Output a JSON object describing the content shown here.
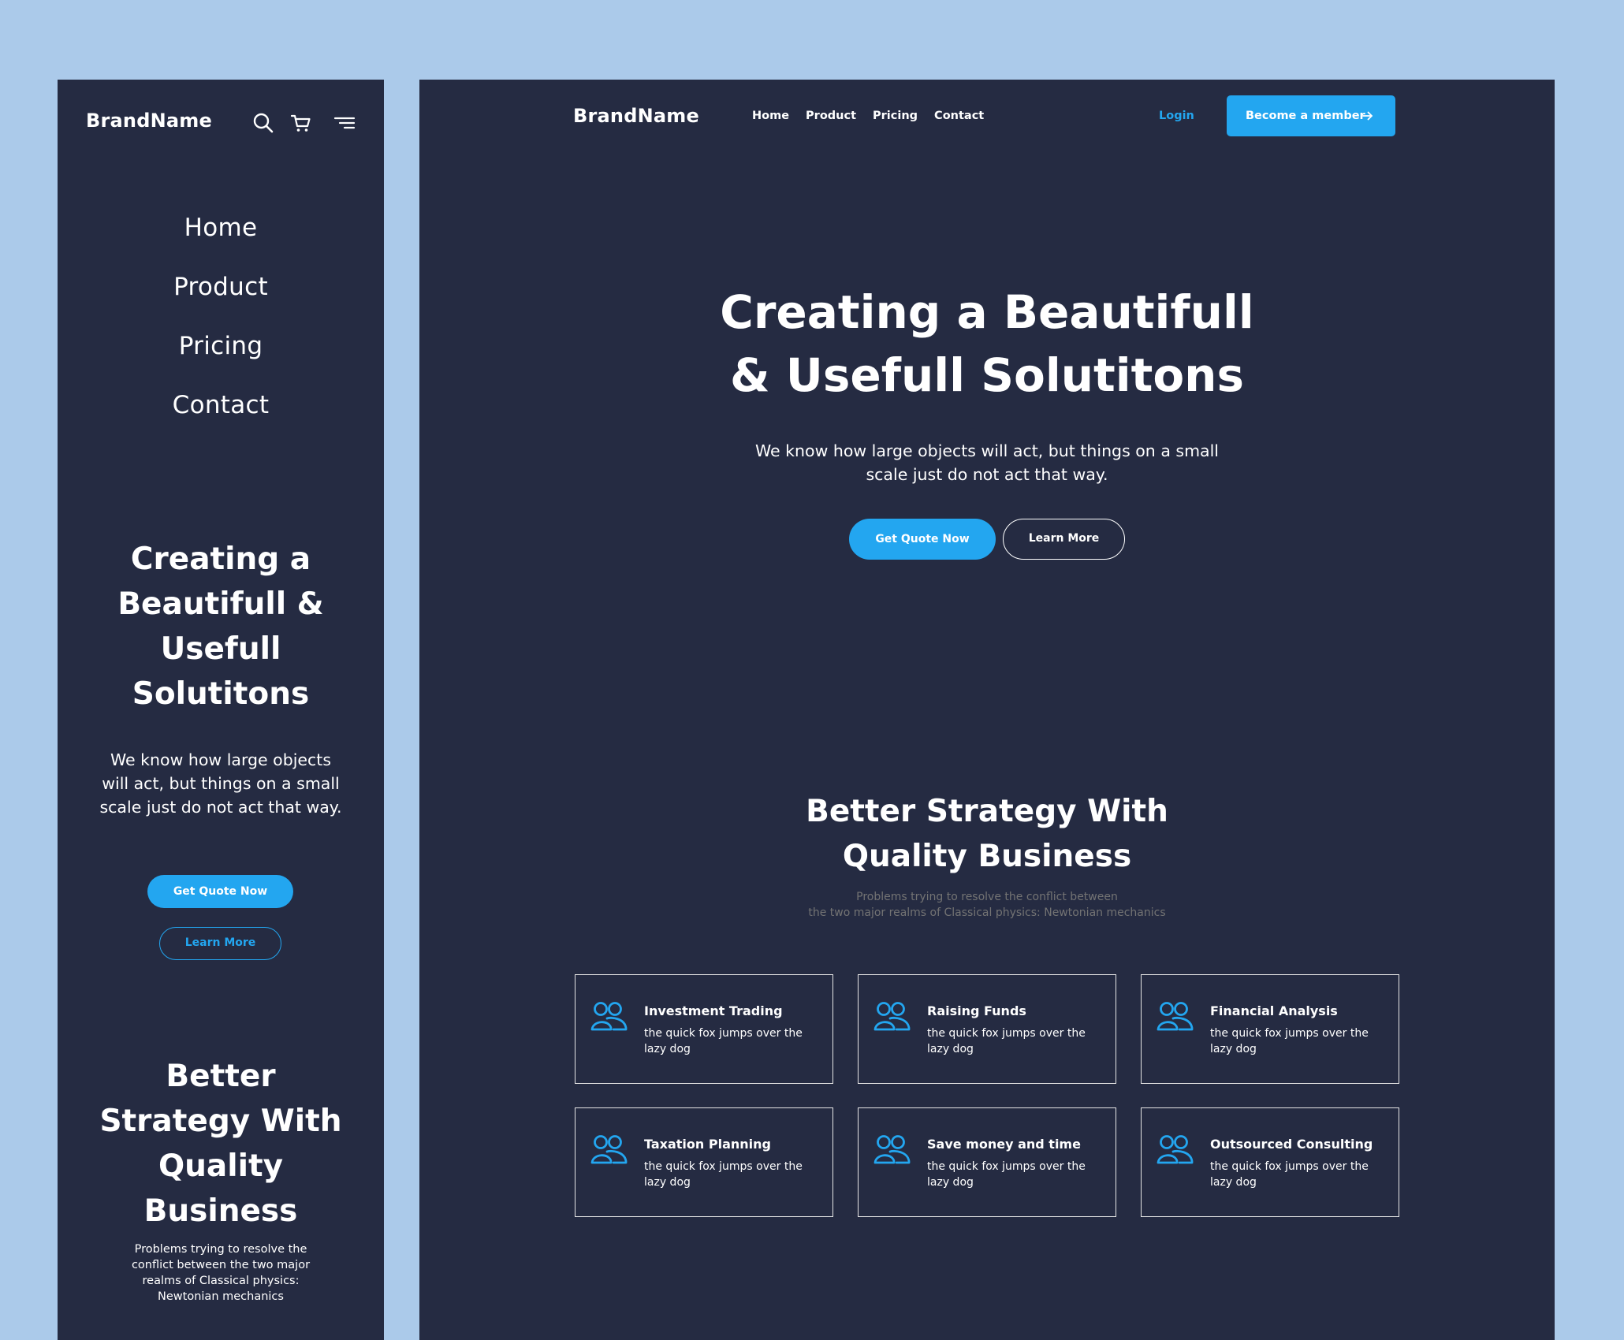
{
  "brand": "BrandName",
  "accent_color": "#23a6f0",
  "background_color": "#252b42",
  "mobile": {
    "header_icons": [
      "search-icon",
      "cart-icon",
      "menu-icon"
    ],
    "nav": [
      "Home",
      "Product",
      "Pricing",
      "Contact"
    ],
    "hero_title": "Creating a Beautifull & Usefull Solutitons",
    "hero_text": "We know how large objects will act, but things on a small scale just do not act that way.",
    "primary_button": "Get Quote Now",
    "secondary_button": "Learn More",
    "section_title": "Better Strategy With Quality Business",
    "section_text": "Problems trying to resolve the conflict between the two major realms of Classical physics: Newtonian mechanics"
  },
  "desktop": {
    "nav": [
      "Home",
      "Product",
      "Pricing",
      "Contact"
    ],
    "login": "Login",
    "member_button": "Become a member",
    "hero_title_line1": "Creating a Beautifull",
    "hero_title_line2": "& Usefull Solutitons",
    "hero_text": "We know how large objects will act, but things on a small scale just do not act that way.",
    "primary_button": "Get Quote Now",
    "secondary_button": "Learn More",
    "section_title_line1": "Better Strategy With",
    "section_title_line2": "Quality Business",
    "section_text_line1": "Problems trying to resolve the conflict between",
    "section_text_line2": "the two major realms of Classical physics: Newtonian mechanics",
    "cards": [
      {
        "title": "Investment Trading",
        "desc": "the quick fox jumps over the lazy dog",
        "icon": "users-icon"
      },
      {
        "title": "Raising Funds",
        "desc": "the quick fox jumps over the lazy dog",
        "icon": "users-icon"
      },
      {
        "title": "Financial Analysis",
        "desc": "the quick fox jumps over the lazy dog",
        "icon": "users-icon"
      },
      {
        "title": "Taxation Planning",
        "desc": "the quick fox jumps over the lazy dog",
        "icon": "users-icon"
      },
      {
        "title": "Save money and time",
        "desc": "the quick fox jumps over the lazy dog",
        "icon": "users-icon"
      },
      {
        "title": "Outsourced Consulting",
        "desc": "the quick fox jumps over the lazy dog",
        "icon": "users-icon"
      }
    ]
  }
}
